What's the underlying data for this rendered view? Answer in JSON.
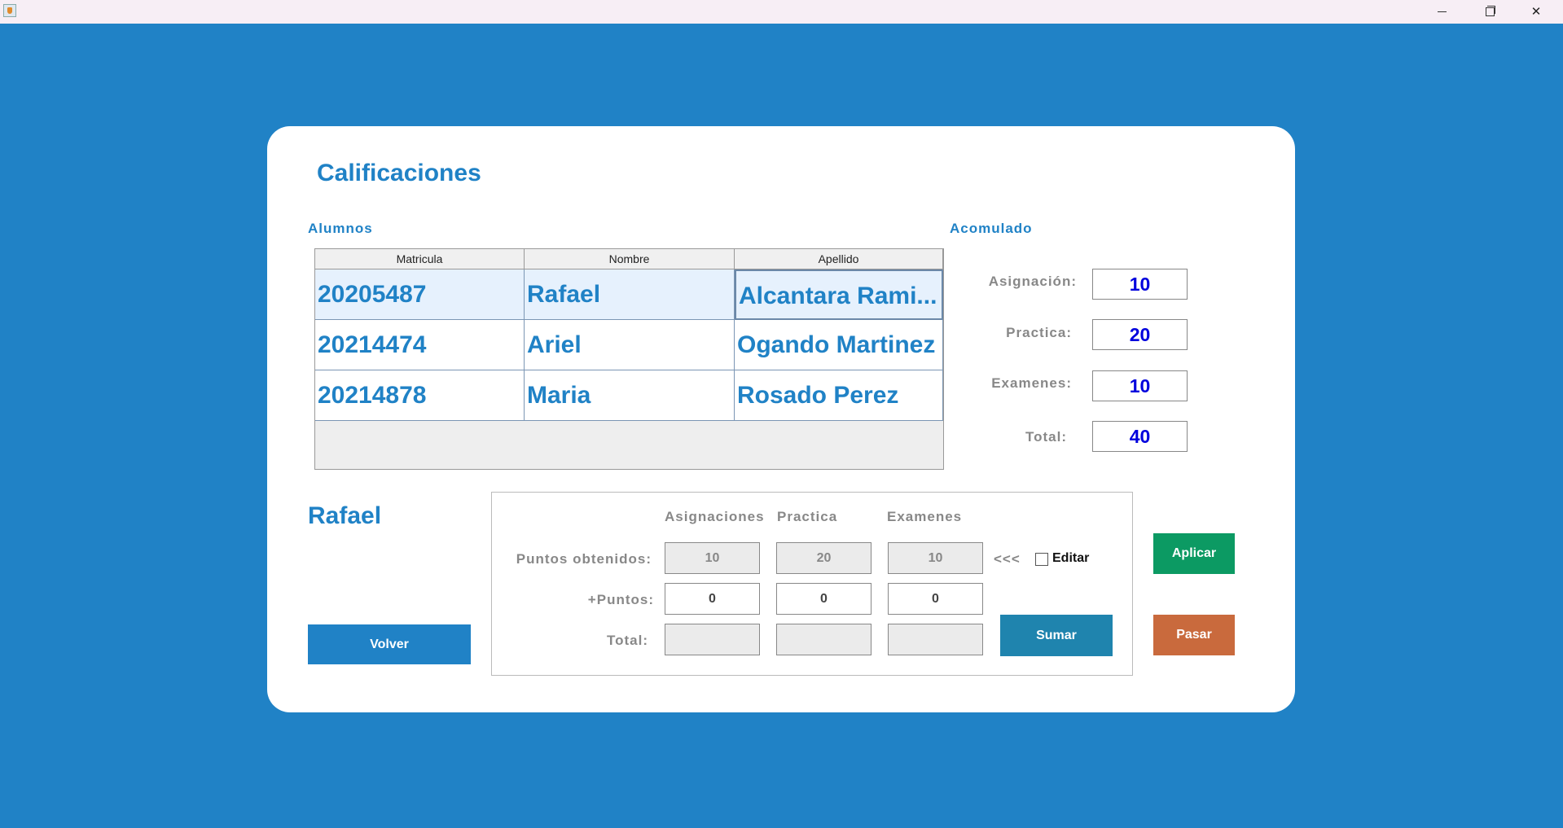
{
  "window": {
    "minimize_glyph": "",
    "maximize_glyph": "",
    "close_glyph": "✕"
  },
  "page": {
    "title": "Calificaciones"
  },
  "students_section": {
    "label": "Alumnos",
    "table": {
      "headers": [
        "Matricula",
        "Nombre",
        "Apellido"
      ],
      "rows": [
        [
          "20205487",
          "Rafael",
          "Alcantara Rami..."
        ],
        [
          "20214474",
          "Ariel",
          "Ogando Martinez"
        ],
        [
          "20214878",
          "Maria",
          "Rosado Perez"
        ]
      ],
      "selected_row": 0
    }
  },
  "accumulated": {
    "label": "Acomulado",
    "asignacion_label": "Asignación:",
    "asignacion_value": "10",
    "practica_label": "Practica:",
    "practica_value": "20",
    "examenes_label": "Examenes:",
    "examenes_value": "10",
    "total_label": "Total:",
    "total_value": "40"
  },
  "selected_student": {
    "name": "Rafael"
  },
  "grades_panel": {
    "columns": [
      "Asignaciones",
      "Practica",
      "Examenes"
    ],
    "puntos_obtenidos_label": "Puntos obtenidos:",
    "puntos_obtenidos": [
      "10",
      "20",
      "10"
    ],
    "plus_puntos_label": "+Puntos:",
    "plus_puntos": [
      "0",
      "0",
      "0"
    ],
    "total_label": "Total:",
    "total": [
      "",
      "",
      ""
    ],
    "arrows": "<<<",
    "editar_label": "Editar",
    "editar_checked": false
  },
  "buttons": {
    "volver": "Volver",
    "sumar": "Sumar",
    "aplicar": "Aplicar",
    "pasar": "Pasar"
  },
  "colors": {
    "background": "#2082c6",
    "accent": "#2082c6",
    "value_blue": "#0000dd",
    "aplicar": "#0c9a63",
    "pasar": "#c96a3d",
    "sumar": "#1f84ae"
  }
}
